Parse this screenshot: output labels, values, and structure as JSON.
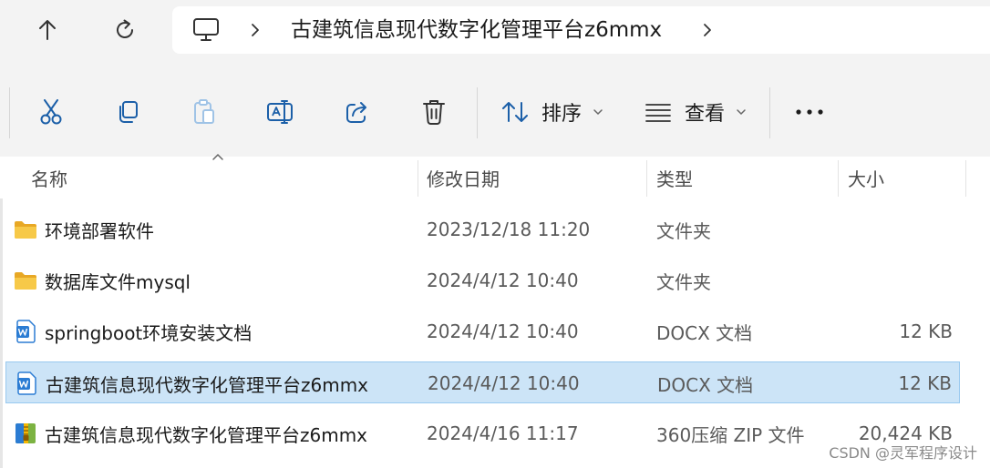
{
  "navigation": {
    "up_icon": "arrow-up-icon",
    "refresh_icon": "refresh-icon",
    "address": {
      "location_icon": "this-pc-icon",
      "current_folder": "古建筑信息现代数字化管理平台z6mmx"
    }
  },
  "commandbar": {
    "buttons": [
      {
        "name": "cut",
        "icon": "scissors-icon"
      },
      {
        "name": "copy",
        "icon": "copy-icon"
      },
      {
        "name": "paste",
        "icon": "paste-icon",
        "disabled": true
      },
      {
        "name": "rename",
        "icon": "rename-icon"
      },
      {
        "name": "share",
        "icon": "share-icon"
      },
      {
        "name": "delete",
        "icon": "trash-icon"
      }
    ],
    "sort_label": "排序",
    "view_label": "查看",
    "more_label": "•••"
  },
  "columns": {
    "name": "名称",
    "date": "修改日期",
    "type": "类型",
    "size": "大小"
  },
  "files": [
    {
      "icon": "folder-icon",
      "name": "环境部署软件",
      "date": "2023/12/18 11:20",
      "type": "文件夹",
      "size": "",
      "selected": false
    },
    {
      "icon": "folder-icon",
      "name": "数据库文件mysql",
      "date": "2024/4/12 10:40",
      "type": "文件夹",
      "size": "",
      "selected": false
    },
    {
      "icon": "word-doc-icon",
      "name": "springboot环境安装文档",
      "date": "2024/4/12 10:40",
      "type": "DOCX 文档",
      "size": "12 KB",
      "selected": false
    },
    {
      "icon": "word-doc-icon",
      "name": "古建筑信息现代数字化管理平台z6mmx",
      "date": "2024/4/12 10:40",
      "type": "DOCX 文档",
      "size": "12 KB",
      "selected": true
    },
    {
      "icon": "zip-archive-icon",
      "name": "古建筑信息现代数字化管理平台z6mmx",
      "date": "2024/4/16 11:17",
      "type": "360压缩 ZIP 文件",
      "size": "20,424 KB",
      "selected": false
    }
  ],
  "watermark": "CSDN @灵军程序设计",
  "colors": {
    "selection_bg": "#cce4f7",
    "selection_border": "#99c9ef",
    "folder_yellow": "#f7c948",
    "word_blue": "#2b7cd3",
    "icon_stroke": "#1b5fa8"
  }
}
